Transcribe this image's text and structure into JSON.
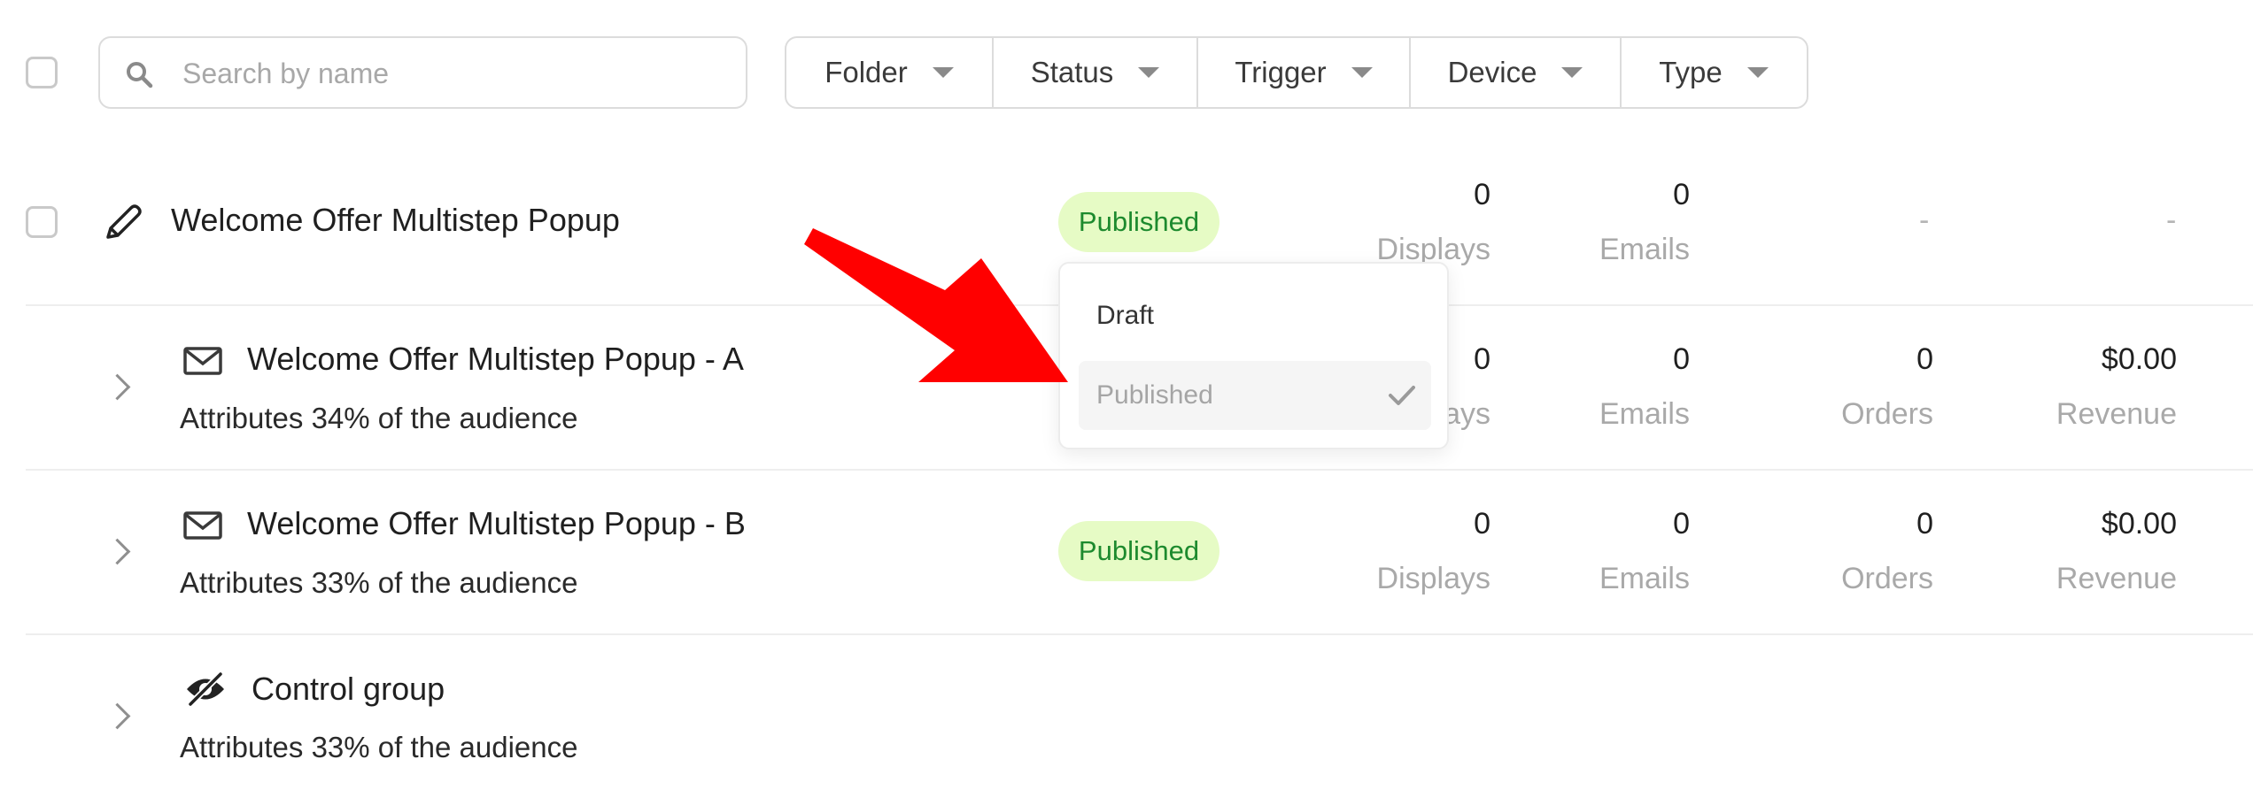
{
  "toolbar": {
    "search_placeholder": "Search by name",
    "filters": [
      "Folder",
      "Status",
      "Trigger",
      "Device",
      "Type"
    ]
  },
  "campaign": {
    "name": "Welcome Offer Multistep Popup",
    "status": "Published",
    "metrics": [
      {
        "value": "0",
        "label": "Displays"
      },
      {
        "value": "0",
        "label": "Emails"
      },
      {
        "value": "-"
      },
      {
        "value": "-"
      }
    ]
  },
  "variants": [
    {
      "name": "Welcome Offer Multistep Popup - A",
      "sub": "Attributes 34% of the audience",
      "icon": "envelope-icon",
      "metrics": [
        {
          "value": "0",
          "label": "Displays"
        },
        {
          "value": "0",
          "label": "Emails"
        },
        {
          "value": "0",
          "label": "Orders"
        },
        {
          "value": "$0.00",
          "label": "Revenue"
        }
      ]
    },
    {
      "name": "Welcome Offer Multistep Popup - B",
      "sub": "Attributes 33% of the audience",
      "icon": "envelope-icon",
      "status": "Published",
      "metrics": [
        {
          "value": "0",
          "label": "Displays"
        },
        {
          "value": "0",
          "label": "Emails"
        },
        {
          "value": "0",
          "label": "Orders"
        },
        {
          "value": "$0.00",
          "label": "Revenue"
        }
      ]
    },
    {
      "name": "Control group",
      "sub": "Attributes 33% of the audience",
      "icon": "eye-slash-icon"
    }
  ],
  "status_dropdown": {
    "options": [
      "Draft",
      "Published"
    ],
    "selected": "Published"
  },
  "colors": {
    "badge_bg": "#e6fbc5",
    "badge_text": "#1d8a2e",
    "annotation_arrow": "#ff0000"
  }
}
